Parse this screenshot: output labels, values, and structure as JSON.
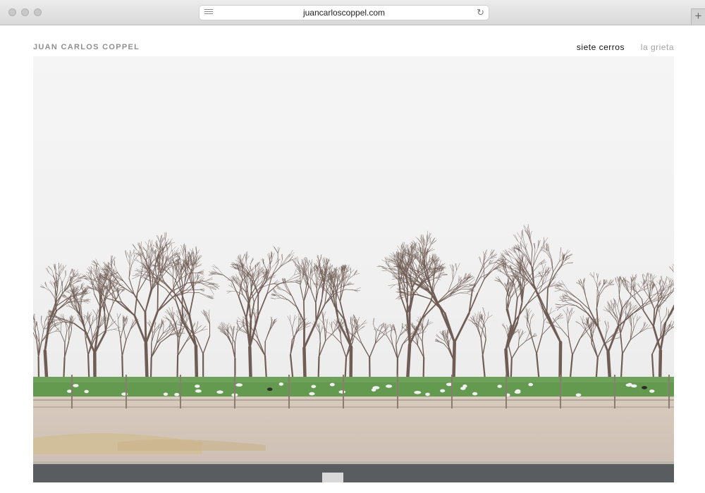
{
  "browser": {
    "url": "juancarloscoppel.com",
    "reader_icon": "reader-icon",
    "reload_icon": "reload-icon",
    "newtab_icon": "plus-icon",
    "newtab_label": "+"
  },
  "site": {
    "title": "JUAN CARLOS COPPEL"
  },
  "nav": {
    "items": [
      {
        "label": "siete cerros",
        "active": true
      },
      {
        "label": "la grieta",
        "active": false
      }
    ]
  },
  "photo": {
    "subject": "orchard-landscape",
    "colors": {
      "sky": "#f4f4f4",
      "trees": "#6e5a52",
      "grass": "#5f9a4a",
      "dirt": "#d9cdc0",
      "road": "#5b5e61"
    }
  }
}
